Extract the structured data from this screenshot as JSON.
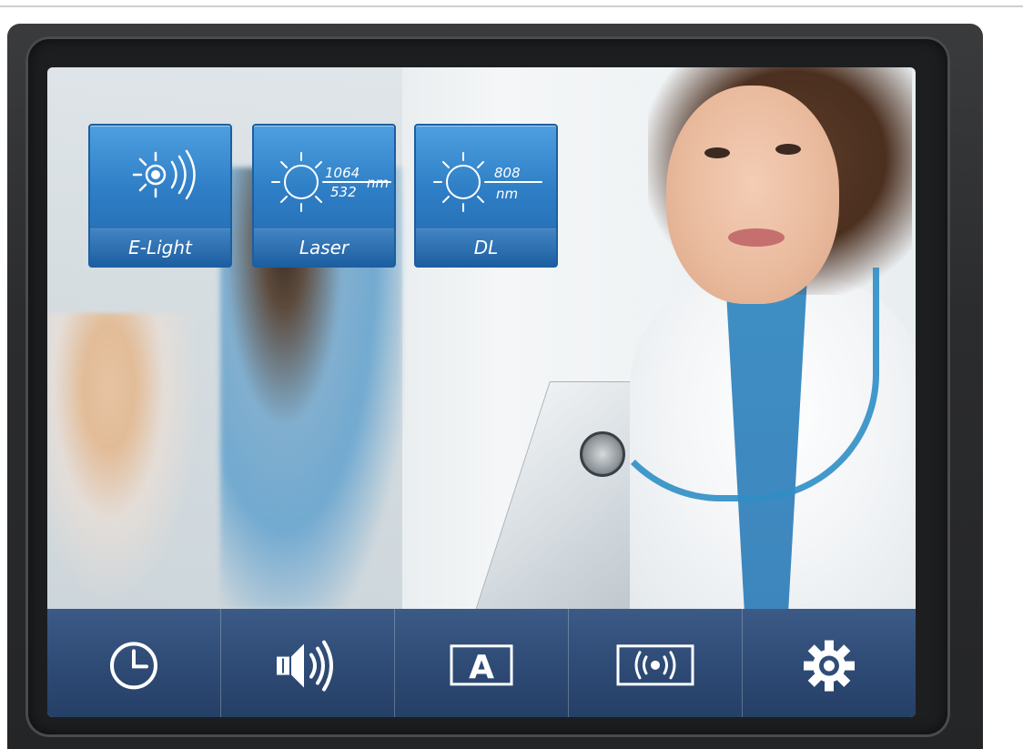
{
  "modes": [
    {
      "label": "E-Light",
      "icon": "light-emitter-icon"
    },
    {
      "label": "Laser",
      "icon": "laser-sun-icon",
      "wavelength_top": "1064",
      "wavelength_bottom": "532",
      "unit": "nm"
    },
    {
      "label": "DL",
      "icon": "diode-laser-sun-icon",
      "wavelength_top": "808",
      "unit": "nm"
    }
  ],
  "toolbar": {
    "items": [
      {
        "name": "clock",
        "icon": "clock-icon"
      },
      {
        "name": "sound",
        "icon": "speaker-icon"
      },
      {
        "name": "language",
        "icon": "letter-a-icon",
        "letter": "A"
      },
      {
        "name": "signal",
        "icon": "wireless-signal-icon"
      },
      {
        "name": "settings",
        "icon": "gear-icon"
      }
    ]
  },
  "colors": {
    "tile_blue": "#2f7fc6",
    "toolbar_navy": "#304d78",
    "icon_white": "#ffffff"
  }
}
